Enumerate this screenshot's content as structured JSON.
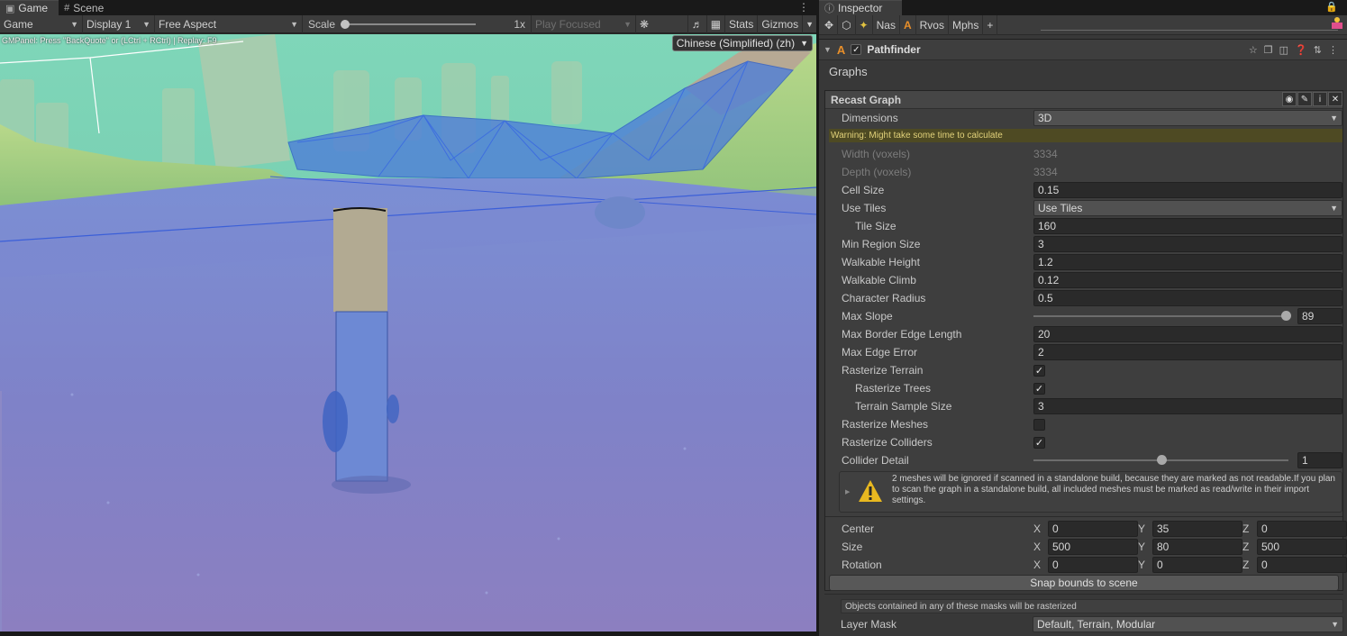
{
  "game_panel": {
    "tabs": [
      {
        "label": "Game",
        "icon": "gamepad-icon"
      },
      {
        "label": "Scene",
        "icon": "grid-icon"
      }
    ],
    "toolbar": {
      "view_mode": "Game",
      "display": "Display 1",
      "aspect": "Free Aspect",
      "scale_label": "Scale",
      "scale_value": "1x",
      "play_mode": "Play Focused",
      "stats_label": "Stats",
      "gizmos_label": "Gizmos"
    },
    "viewport": {
      "overlay_text": "GMPanel: Press \"BackQuote\" or (LCtrl + RCtrl) | Replay: F9",
      "language": "Chinese (Simplified) (zh)"
    }
  },
  "inspector": {
    "tab_label": "Inspector",
    "toolbar": {
      "items": [
        "Nas",
        "Rvos",
        "Mphs",
        "+"
      ]
    },
    "component": {
      "title": "Pathfinder",
      "enabled": true
    },
    "graphs_label": "Graphs",
    "graph": {
      "title": "Recast Graph",
      "dimensions_label": "Dimensions",
      "dimensions_value": "3D",
      "warning_text": "Warning: Might take some time to calculate",
      "width_label": "Width (voxels)",
      "width_value": "3334",
      "depth_label": "Depth (voxels)",
      "depth_value": "3334",
      "cell_size_label": "Cell Size",
      "cell_size_value": "0.15",
      "use_tiles_label": "Use Tiles",
      "use_tiles_value": "Use Tiles",
      "tile_size_label": "Tile Size",
      "tile_size_value": "160",
      "min_region_label": "Min Region Size",
      "min_region_value": "3",
      "walkable_height_label": "Walkable Height",
      "walkable_height_value": "1.2",
      "walkable_climb_label": "Walkable Climb",
      "walkable_climb_value": "0.12",
      "char_radius_label": "Character Radius",
      "char_radius_value": "0.5",
      "max_slope_label": "Max Slope",
      "max_slope_value": "89",
      "max_slope_fraction": 0.989,
      "max_border_label": "Max Border Edge Length",
      "max_border_value": "20",
      "max_edge_error_label": "Max Edge Error",
      "max_edge_error_value": "2",
      "rasterize_terrain_label": "Rasterize Terrain",
      "rasterize_terrain": true,
      "rasterize_trees_label": "Rasterize Trees",
      "rasterize_trees": true,
      "terrain_sample_label": "Terrain Sample Size",
      "terrain_sample_value": "3",
      "rasterize_meshes_label": "Rasterize Meshes",
      "rasterize_meshes": false,
      "rasterize_colliders_label": "Rasterize Colliders",
      "rasterize_colliders": true,
      "collider_detail_label": "Collider Detail",
      "collider_detail_value": "1",
      "collider_detail_fraction": 0.5,
      "help_text": "2 meshes will be ignored if scanned in a standalone build, because they are marked as not readable.If you plan to scan the graph in a standalone build, all included meshes must be marked as read/write in their import settings.",
      "center_label": "Center",
      "center": {
        "x": "0",
        "y": "35",
        "z": "0"
      },
      "size_label": "Size",
      "size": {
        "x": "500",
        "y": "80",
        "z": "500"
      },
      "rotation_label": "Rotation",
      "rotation": {
        "x": "0",
        "y": "0",
        "z": "0"
      },
      "axis_labels": {
        "x": "X",
        "y": "Y",
        "z": "Z"
      },
      "snap_button": "Snap bounds to scene",
      "mask_info": "Objects contained in any of these masks will be rasterized",
      "layer_mask_label": "Layer Mask",
      "layer_mask_value": "Default, Terrain, Modular"
    }
  },
  "colors": {
    "editor_bg": "#383838",
    "field_bg": "#2a2a2a",
    "warning_bg": "#4e4a23",
    "warning_text": "#e1d17a",
    "warning_icon": "#e8b820"
  }
}
